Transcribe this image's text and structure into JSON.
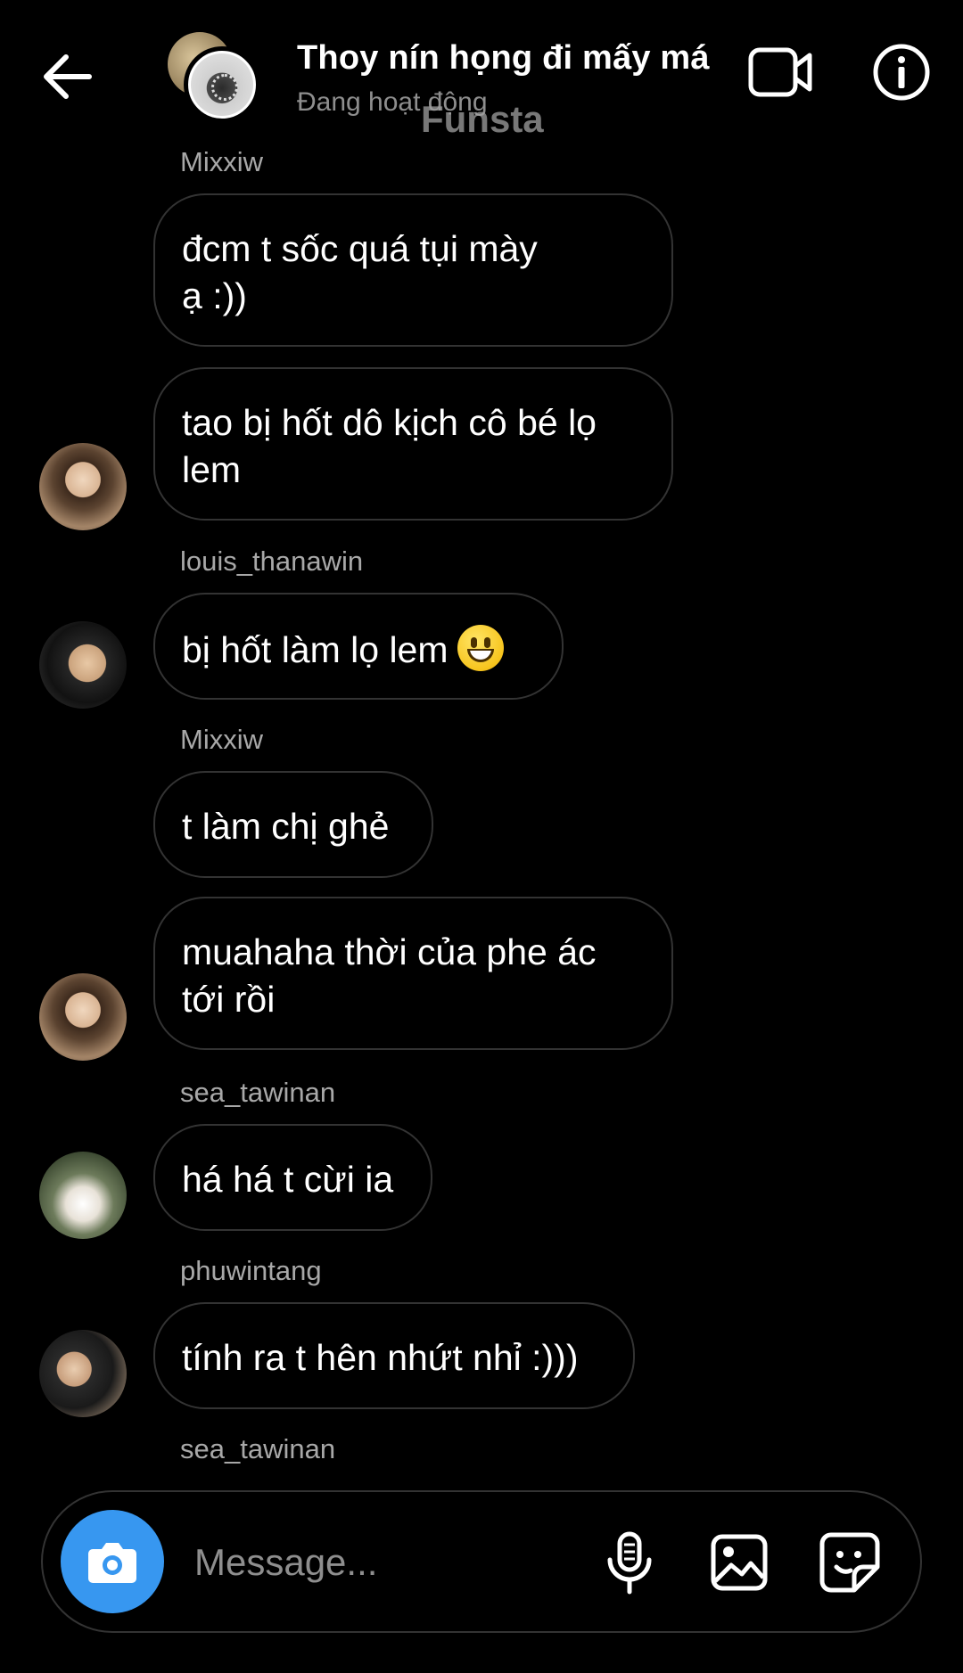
{
  "header": {
    "title": "Thoy nín họng đi mấy má",
    "status": "Đang hoạt động",
    "watermark": "Funsta",
    "icons": [
      "back-arrow-icon",
      "video-call-icon",
      "info-icon"
    ]
  },
  "messages": [
    {
      "sender": "Mixxiw",
      "text": "đcm t sốc quá tụi mày\nạ :))"
    },
    {
      "sender": "",
      "text": "tao bị hốt dô kịch cô bé lọ\nlem"
    },
    {
      "sender": "louis_thanawin",
      "text": "bị hốt làm lọ lem",
      "emoji": "grinning-face-emoji"
    },
    {
      "sender": "Mixxiw",
      "text": "t làm chị ghẻ"
    },
    {
      "sender": "",
      "text": "muahaha thời của phe ác\ntới rồi"
    },
    {
      "sender": "sea_tawinan",
      "text": "há há t cừi ia"
    },
    {
      "sender": "phuwintang",
      "text": "tính ra t hên nhứt nhỉ :)))"
    },
    {
      "sender": "sea_tawinan",
      "text": ""
    }
  ],
  "composer": {
    "placeholder": "Message...",
    "icons": [
      "camera-icon",
      "microphone-icon",
      "gallery-icon",
      "sticker-icon"
    ]
  },
  "colors": {
    "background": "#000000",
    "bubble_border": "#333333",
    "sender_name": "#a8a8a8",
    "status_text": "#8e8e8e",
    "camera_button": "#3797f0"
  }
}
